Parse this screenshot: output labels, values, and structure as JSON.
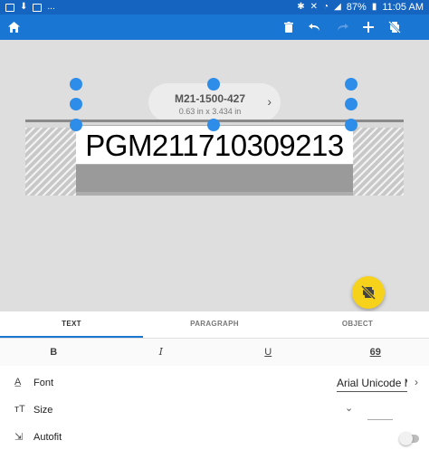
{
  "status_bar": {
    "battery": "87%",
    "time": "11:05 AM",
    "more": "...",
    "left_icons": [
      "image-icon",
      "download-icon",
      "flipboard-icon"
    ],
    "right_icons": [
      "bluetooth-icon",
      "mute-icon",
      "wifi-icon",
      "signal-icon",
      "battery-icon"
    ]
  },
  "toolbar": {
    "bg_color": "#1976d2",
    "icons": [
      "home-icon",
      "delete-icon",
      "undo-icon",
      "redo-icon",
      "add-icon",
      "print-disabled-icon"
    ]
  },
  "label": {
    "part_number": "M21-1500-427",
    "dimensions": "0.63 in x 3.434 in",
    "content": "PGM211710309213"
  },
  "fab": {
    "icon": "print-off-icon",
    "color": "#f7d21a"
  },
  "tabs": [
    {
      "label": "TEXT",
      "active": true
    },
    {
      "label": "PARAGRAPH",
      "active": false
    },
    {
      "label": "OBJECT",
      "active": false
    }
  ],
  "format": {
    "bold": "B",
    "italic": "I",
    "underline": "U",
    "special": "69"
  },
  "properties": {
    "font": {
      "label": "Font",
      "value": "Arial Unicode M"
    },
    "size": {
      "label": "Size",
      "value": ""
    },
    "autofit": {
      "label": "Autofit",
      "enabled": false
    }
  }
}
